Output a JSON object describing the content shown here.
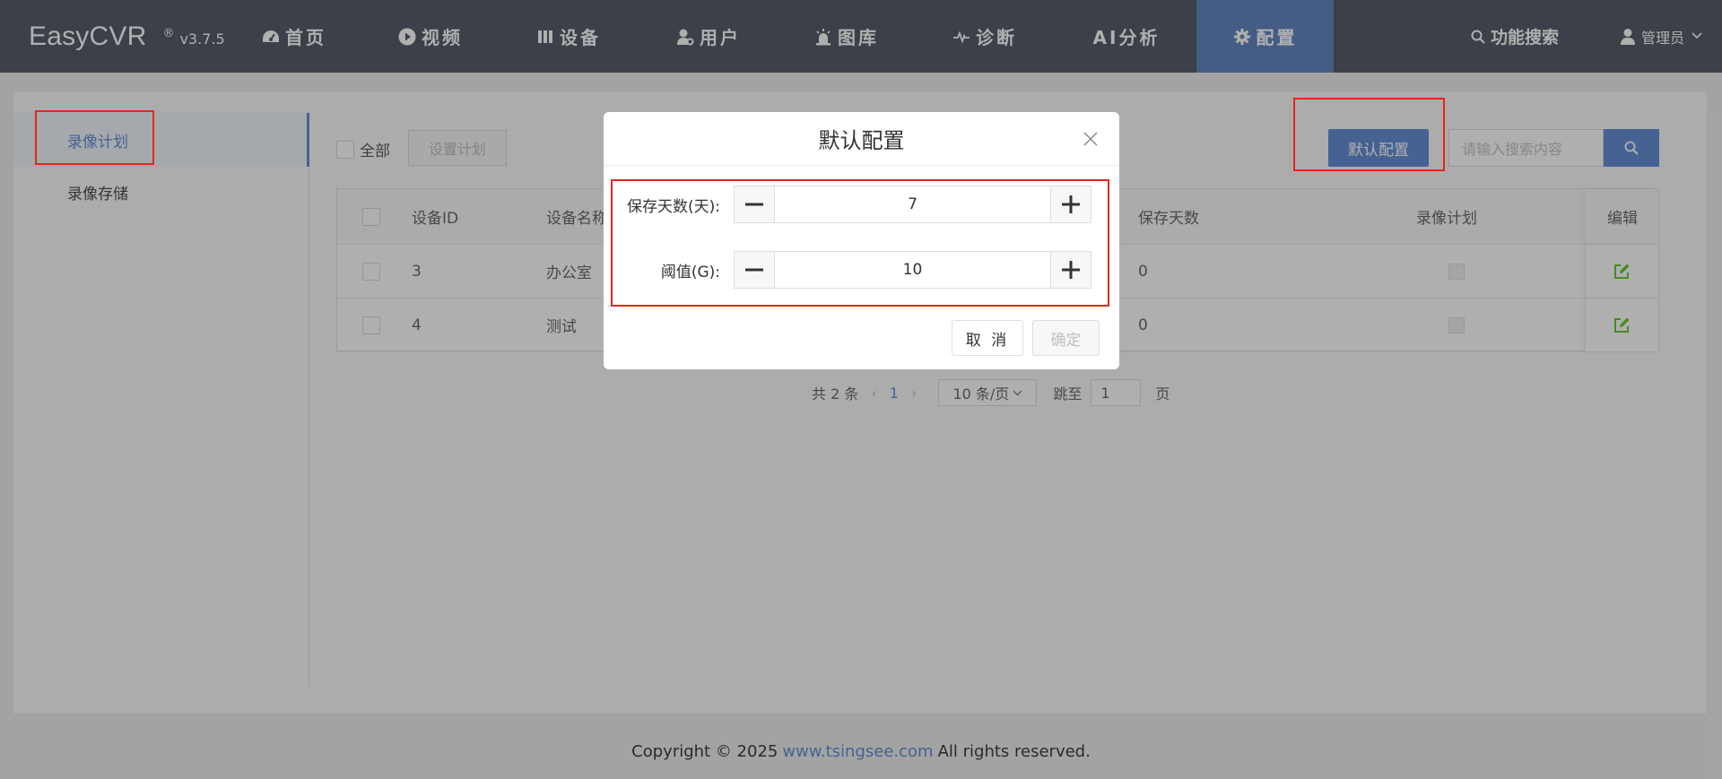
{
  "brand": {
    "name": "EasyCVR",
    "reg": "®",
    "version": "v3.7.5"
  },
  "nav": {
    "items": [
      {
        "label": "首页",
        "icon": "dashboard-icon"
      },
      {
        "label": "视频",
        "icon": "play-circle-icon"
      },
      {
        "label": "设备",
        "icon": "device-icon"
      },
      {
        "label": "用户",
        "icon": "user-gear-icon"
      },
      {
        "label": "图库",
        "icon": "alarm-icon"
      },
      {
        "label": "诊断",
        "icon": "pulse-icon"
      },
      {
        "label": "AI分析",
        "icon": ""
      },
      {
        "label": "配置",
        "icon": "gear-icon"
      }
    ],
    "active": "配置",
    "search_label": "功能搜索",
    "user_label": "管理员"
  },
  "sidebar": {
    "items": [
      {
        "label": "录像计划"
      },
      {
        "label": "录像存储"
      }
    ],
    "active": "录像计划"
  },
  "toolbar": {
    "all_label": "全部",
    "set_plan_label": "设置计划",
    "default_config_label": "默认配置",
    "search_placeholder": "请输入搜索内容"
  },
  "table": {
    "headers": {
      "device_id": "设备ID",
      "device_name": "设备名称",
      "save_days": "保存天数",
      "schedule": "录像计划",
      "edit": "编辑"
    },
    "rows": [
      {
        "device_id": "3",
        "device_name": "办公室",
        "save_days": "0"
      },
      {
        "device_id": "4",
        "device_name": "测试",
        "save_days": "0"
      }
    ]
  },
  "pagination": {
    "total": "共 2 条",
    "prev": "‹",
    "current": "1",
    "next": "›",
    "page_size": "10 条/页",
    "jump_label": "跳至",
    "jump_value": "1",
    "page_label": "页"
  },
  "modal": {
    "title": "默认配置",
    "fields": [
      {
        "label": "保存天数(天):",
        "value": "7"
      },
      {
        "label": "阈值(G):",
        "value": "10"
      }
    ],
    "cancel_label": "取 消",
    "ok_label": "确定"
  },
  "footer": {
    "prefix": "Copyright © 2025",
    "link": "www.tsingsee.com",
    "suffix": "All rights reserved."
  },
  "colors": {
    "nav_bg": "#3e4755",
    "nav_active": "#4f75b8",
    "primary": "#4f7fcf",
    "highlight": "#e8241f",
    "edit_icon": "#52c41a"
  }
}
